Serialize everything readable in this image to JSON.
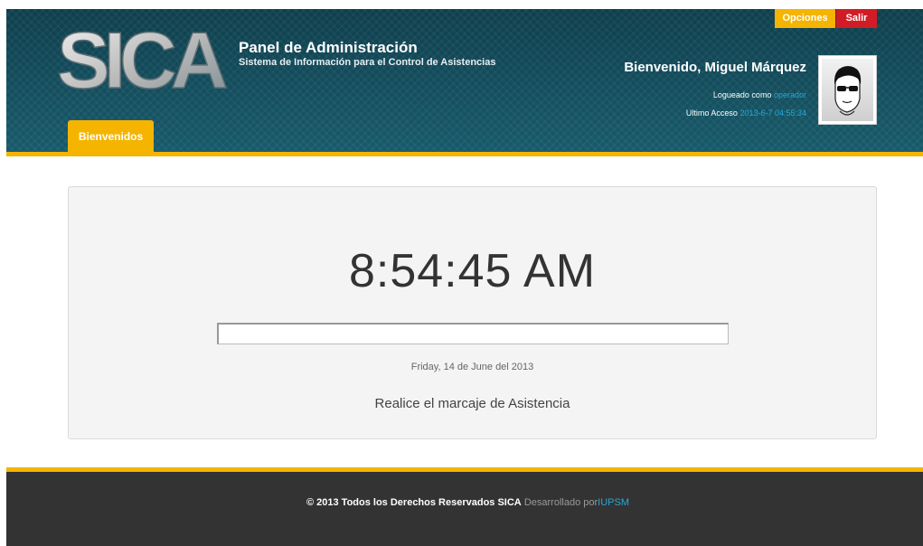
{
  "header": {
    "logo_text": "SICA",
    "title": "Panel de Administración",
    "subtitle": "Sistema de Información para el Control de Asistencias",
    "buttons": {
      "opciones": "Opciones",
      "salir": "Salir"
    },
    "welcome": "Bienvenido, Miguel Márquez",
    "login_prefix": "Logueado como",
    "login_user": "operador",
    "access_prefix": "Ultimo Acceso",
    "access_time": "2013-6-7 04:55:34",
    "tab": "Bienvenidos"
  },
  "main": {
    "clock": "8:54:45 AM",
    "input_value": "",
    "date": "Friday, 14 de June del 2013",
    "instruction": "Realice el marcaje de Asistencia"
  },
  "footer": {
    "copyright": "© 2013 Todos los Derechos Reservados SICA",
    "developed_by": "Desarrollado por",
    "org": "IUPSM"
  },
  "colors": {
    "header_bg": "#114a5a",
    "accent": "#f4b400",
    "danger": "#d21c25",
    "link": "#27a8d6",
    "footer_bg": "#333333"
  },
  "icons": {
    "logo": "sica-logo",
    "avatar": "user-avatar-icon"
  }
}
